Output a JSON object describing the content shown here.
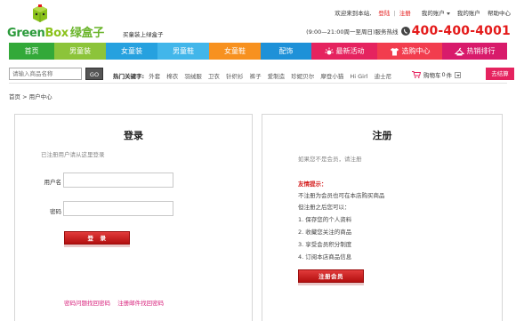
{
  "brand": {
    "wordmark_green": "Green",
    "wordmark_box": "Box",
    "wordmark_cn": "绿盒子",
    "slogan": "买童装上绿盒子",
    "green": "#2a9a3a",
    "lime": "#8bc21c"
  },
  "toplinks": {
    "welcome": "欢迎来到本站,",
    "login": "登陆",
    "sep": "|",
    "register": "注册",
    "my_account": "我的账户",
    "my_account2": "我的账户",
    "help": "帮助中心"
  },
  "hotline": {
    "hours": "(9:00—21:00周一至周日)服务热线",
    "number": "400-400-4001",
    "icon": "phone-icon"
  },
  "nav": {
    "items": [
      {
        "label": "首页",
        "color": "#33a939"
      },
      {
        "label": "男童装",
        "color": "#8cc43a"
      },
      {
        "label": "女童装",
        "color": "#26a1df"
      },
      {
        "label": "男童鞋",
        "color": "#42b6ea"
      },
      {
        "label": "女童鞋",
        "color": "#f7911f"
      },
      {
        "label": "配饰",
        "color": "#1e91d8"
      },
      {
        "label": "最新活动",
        "color": "#e5235f",
        "icon": "sun-icon"
      },
      {
        "label": "选购中心",
        "color": "#f23d4e",
        "icon": "shirt-icon"
      },
      {
        "label": "热销排行",
        "color": "#d81b6b",
        "icon": "hanger-icon"
      }
    ]
  },
  "search": {
    "placeholder": "请输入商品名称",
    "go_label": "GO",
    "hot_label": "热门关键字:",
    "keywords": [
      "外套",
      "棉衣",
      "羽绒服",
      "卫衣",
      "针织衫",
      "裤子",
      "爱制造",
      "珍妮贝尔",
      "摩登小猫",
      "Hi Girl",
      "迪士尼"
    ]
  },
  "cart": {
    "label": "购物车",
    "count": "0",
    "unit": "件",
    "checkout_label": "去结算",
    "icon": "cart-icon"
  },
  "breadcrumb": {
    "home": "首页",
    "current": "> 用户中心"
  },
  "login": {
    "title": "登录",
    "hint": "已注册用户请从这里登录",
    "username_label": "用户名",
    "password_label": "密码",
    "username_value": "",
    "password_value": "",
    "submit_label": "登　录",
    "forgot_password": "密码问题找回密码",
    "forgot_email": "注册邮件找回密码"
  },
  "register": {
    "title": "注册",
    "hint": "如果您不是会员，请注册",
    "promo_title": "友情提示：",
    "promo_lines": [
      "不注册为会员也可在本店购买商品",
      "但注册之后您可以：",
      "1. 保存您的个人资料",
      "2. 收藏您关注的商品",
      "3. 享受会员积分制度",
      "4. 订阅本店商品信息"
    ],
    "submit_label": "注册会员"
  }
}
